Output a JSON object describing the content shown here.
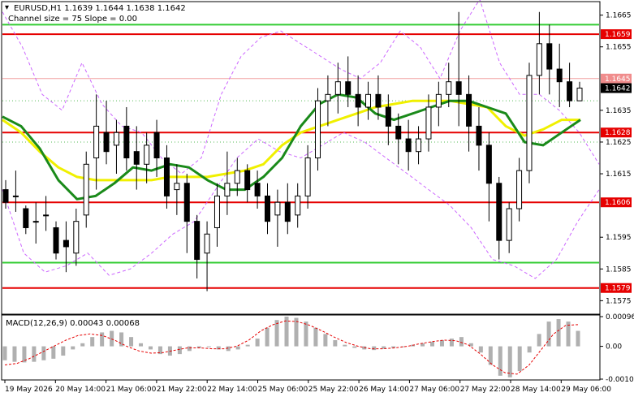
{
  "header": {
    "symbol_line": "EURUSD,H1  1.1639 1.1644 1.1638 1.1642",
    "channel_line": "Channel size = 75 Slope = 0.00"
  },
  "macd_label": "MACD(12,26,9) 0.00043 0.00068",
  "colors": {
    "red_level": "#e60000",
    "green_level": "#33cc33",
    "ma_fast": "#1a8a1a",
    "ma_slow": "#f0f000",
    "band": "#cc66ff",
    "candle": "#000000",
    "macd_hist": "#b0b0b0",
    "macd_signal": "#e60000",
    "price_tag": "#000000"
  },
  "chart_data": {
    "type": "candlestick",
    "symbol": "EURUSD",
    "timeframe": "H1",
    "ylim": [
      1.1571,
      1.1669
    ],
    "y_ticks": [
      "1.1665",
      "1.1655",
      "1.1635",
      "1.1625",
      "1.1615",
      "1.1595",
      "1.1585",
      "1.1575"
    ],
    "x_ticks": [
      "19 May 2026",
      "20 May 14:00",
      "21 May 06:00",
      "21 May 22:00",
      "22 May 14:00",
      "25 May 06:00",
      "25 May 22:00",
      "26 May 14:00",
      "27 May 06:00",
      "27 May 22:00",
      "28 May 14:00",
      "29 May 06:00"
    ],
    "red_levels": [
      {
        "value": 1.1659,
        "label": "1.1659"
      },
      {
        "value": 1.1645,
        "label": "1.1645"
      },
      {
        "value": 1.1628,
        "label": "1.1628"
      },
      {
        "value": 1.1606,
        "label": "1.1606"
      },
      {
        "value": 1.1579,
        "label": "1.1579"
      }
    ],
    "green_levels": [
      1.1662,
      1.1587
    ],
    "current_price": {
      "value": 1.1642,
      "label": "1.1642"
    },
    "ma_fast_points": [
      1.1633,
      1.163,
      1.1623,
      1.1613,
      1.1607,
      1.1608,
      1.1612,
      1.1617,
      1.1616,
      1.1618,
      1.1617,
      1.1613,
      1.161,
      1.161,
      1.1614,
      1.162,
      1.163,
      1.1637,
      1.164,
      1.1639,
      1.1634,
      1.1632,
      1.1634,
      1.1636,
      1.1638,
      1.1638,
      1.1636,
      1.1634,
      1.1625,
      1.1624,
      1.1628,
      1.1632
    ],
    "ma_slow_points": [
      1.1632,
      1.1628,
      1.1622,
      1.1617,
      1.1614,
      1.1613,
      1.1613,
      1.1613,
      1.1613,
      1.1614,
      1.1614,
      1.1614,
      1.1615,
      1.1616,
      1.1618,
      1.1624,
      1.1628,
      1.163,
      1.1632,
      1.1634,
      1.1636,
      1.1637,
      1.1638,
      1.1638,
      1.1638,
      1.1637,
      1.1636,
      1.163,
      1.1627,
      1.1629,
      1.1632,
      1.1632
    ],
    "band_upper": [
      1.1666,
      1.1655,
      1.164,
      1.1635,
      1.165,
      1.1637,
      1.163,
      1.1628,
      1.162,
      1.1615,
      1.162,
      1.164,
      1.1652,
      1.1658,
      1.166,
      1.1656,
      1.1652,
      1.1648,
      1.1645,
      1.165,
      1.166,
      1.1655,
      1.1645,
      1.166,
      1.167,
      1.165,
      1.164,
      1.164,
      1.1635,
      1.1628,
      1.1618
    ],
    "band_lower": [
      1.161,
      1.159,
      1.1584,
      1.1586,
      1.159,
      1.1583,
      1.1585,
      1.159,
      1.1596,
      1.16,
      1.161,
      1.162,
      1.1626,
      1.1622,
      1.162,
      1.1624,
      1.1628,
      1.1625,
      1.162,
      1.1615,
      1.161,
      1.1605,
      1.1598,
      1.1588,
      1.1586,
      1.1582,
      1.1588,
      1.16,
      1.161
    ],
    "candles": [
      [
        1.161,
        1.1613,
        1.1606,
        1.1604
      ],
      [
        1.1608,
        1.1616,
        1.1608,
        1.1603
      ],
      [
        1.1604,
        1.1605,
        1.1598,
        1.1596
      ],
      [
        1.16,
        1.1606,
        1.16,
        1.1593
      ],
      [
        1.1602,
        1.1608,
        1.1602,
        1.1597
      ],
      [
        1.1598,
        1.16,
        1.159,
        1.1588
      ],
      [
        1.1594,
        1.16,
        1.1592,
        1.1584
      ],
      [
        1.159,
        1.1604,
        1.16,
        1.1586
      ],
      [
        1.1602,
        1.1622,
        1.1618,
        1.1598
      ],
      [
        1.162,
        1.164,
        1.163,
        1.161
      ],
      [
        1.1628,
        1.1638,
        1.1622,
        1.1618
      ],
      [
        1.1624,
        1.1632,
        1.1628,
        1.1615
      ],
      [
        1.163,
        1.1636,
        1.162,
        1.1616
      ],
      [
        1.1622,
        1.163,
        1.1618,
        1.161
      ],
      [
        1.1618,
        1.1628,
        1.1624,
        1.1612
      ],
      [
        1.1628,
        1.1632,
        1.162,
        1.1614
      ],
      [
        1.162,
        1.1624,
        1.1608,
        1.1604
      ],
      [
        1.161,
        1.1618,
        1.1612,
        1.1602
      ],
      [
        1.1612,
        1.1615,
        1.16,
        1.159
      ],
      [
        1.16,
        1.1602,
        1.1588,
        1.1582
      ],
      [
        1.159,
        1.16,
        1.1596,
        1.1578
      ],
      [
        1.1598,
        1.1612,
        1.1608,
        1.1592
      ],
      [
        1.1608,
        1.1622,
        1.1612,
        1.1602
      ],
      [
        1.1612,
        1.162,
        1.1616,
        1.1608
      ],
      [
        1.1616,
        1.1618,
        1.161,
        1.1606
      ],
      [
        1.1612,
        1.1616,
        1.1608,
        1.1604
      ],
      [
        1.1608,
        1.1612,
        1.16,
        1.1596
      ],
      [
        1.1602,
        1.161,
        1.1606,
        1.1592
      ],
      [
        1.1606,
        1.1612,
        1.16,
        1.1596
      ],
      [
        1.1602,
        1.1612,
        1.1608,
        1.1598
      ],
      [
        1.1608,
        1.1624,
        1.162,
        1.1604
      ],
      [
        1.162,
        1.1642,
        1.1638,
        1.1616
      ],
      [
        1.1638,
        1.1646,
        1.164,
        1.163
      ],
      [
        1.164,
        1.165,
        1.1644,
        1.1634
      ],
      [
        1.1644,
        1.1652,
        1.164,
        1.1636
      ],
      [
        1.164,
        1.1646,
        1.1636,
        1.163
      ],
      [
        1.1636,
        1.1644,
        1.164,
        1.1632
      ],
      [
        1.164,
        1.1646,
        1.1636,
        1.1632
      ],
      [
        1.1636,
        1.164,
        1.163,
        1.1624
      ],
      [
        1.163,
        1.1634,
        1.1626,
        1.1618
      ],
      [
        1.1626,
        1.1632,
        1.1622,
        1.1616
      ],
      [
        1.1622,
        1.163,
        1.1626,
        1.1618
      ],
      [
        1.1626,
        1.164,
        1.1636,
        1.1622
      ],
      [
        1.1636,
        1.1644,
        1.164,
        1.163
      ],
      [
        1.164,
        1.165,
        1.1644,
        1.1636
      ],
      [
        1.1644,
        1.1666,
        1.164,
        1.163
      ],
      [
        1.164,
        1.1646,
        1.163,
        1.1622
      ],
      [
        1.163,
        1.1636,
        1.1624,
        1.1616
      ],
      [
        1.1624,
        1.1628,
        1.1612,
        1.16
      ],
      [
        1.1612,
        1.1614,
        1.1594,
        1.1588
      ],
      [
        1.1594,
        1.1606,
        1.1604,
        1.159
      ],
      [
        1.1604,
        1.162,
        1.1616,
        1.16
      ],
      [
        1.1616,
        1.165,
        1.1646,
        1.1612
      ],
      [
        1.1646,
        1.1666,
        1.1656,
        1.164
      ],
      [
        1.1656,
        1.1662,
        1.1648,
        1.164
      ],
      [
        1.1648,
        1.1656,
        1.1644,
        1.1636
      ],
      [
        1.1644,
        1.165,
        1.1638,
        1.1636
      ],
      [
        1.1638,
        1.1644,
        1.1642,
        1.1638
      ]
    ],
    "macd": {
      "ylim": [
        -0.00106,
        0.00096
      ],
      "y_ticks": [
        "0.00096",
        "0.00",
        "-0.00106"
      ],
      "histogram": [
        -0.00045,
        -0.0005,
        -0.00052,
        -0.0005,
        -0.00045,
        -0.0004,
        -0.0003,
        -0.0001,
        0.0001,
        0.0003,
        0.00045,
        0.0005,
        0.00045,
        0.0003,
        0.0001,
        -0.0001,
        -0.00025,
        -0.0003,
        -0.00025,
        -0.00015,
        -5e-05,
        0.0,
        -0.0001,
        -0.00015,
        -0.0001,
        5e-05,
        0.00025,
        0.0006,
        0.00085,
        0.00096,
        0.00092,
        0.0008,
        0.0006,
        0.0004,
        0.0002,
        5e-05,
        -5e-05,
        -0.0001,
        -0.00012,
        -8e-05,
        -5e-05,
        -2e-05,
        5e-05,
        0.0001,
        0.00015,
        0.0002,
        0.00025,
        0.0003,
        0.0001,
        -0.0002,
        -0.0006,
        -0.00095,
        -0.001,
        -0.0008,
        -0.0002,
        0.0004,
        0.0008,
        0.00088,
        0.0008,
        0.0005
      ],
      "signal": [
        -0.0006,
        -0.00055,
        -0.0004,
        -0.0002,
        0.0,
        0.0002,
        0.00035,
        0.0004,
        0.00035,
        0.0002,
        0.0,
        -0.00015,
        -0.00022,
        -0.0002,
        -0.00012,
        -5e-05,
        -5e-05,
        -8e-05,
        -8e-05,
        0.0,
        0.0002,
        0.0005,
        0.0007,
        0.00082,
        0.0008,
        0.00068,
        0.0005,
        0.0003,
        0.00012,
        0.0,
        -8e-05,
        -8e-05,
        -5e-05,
        0.0,
        8e-05,
        0.00015,
        0.0002,
        0.00018,
        5e-05,
        -0.00025,
        -0.0006,
        -0.00085,
        -0.0009,
        -0.0006,
        -0.0001,
        0.0004,
        0.00068,
        0.0007
      ]
    }
  }
}
